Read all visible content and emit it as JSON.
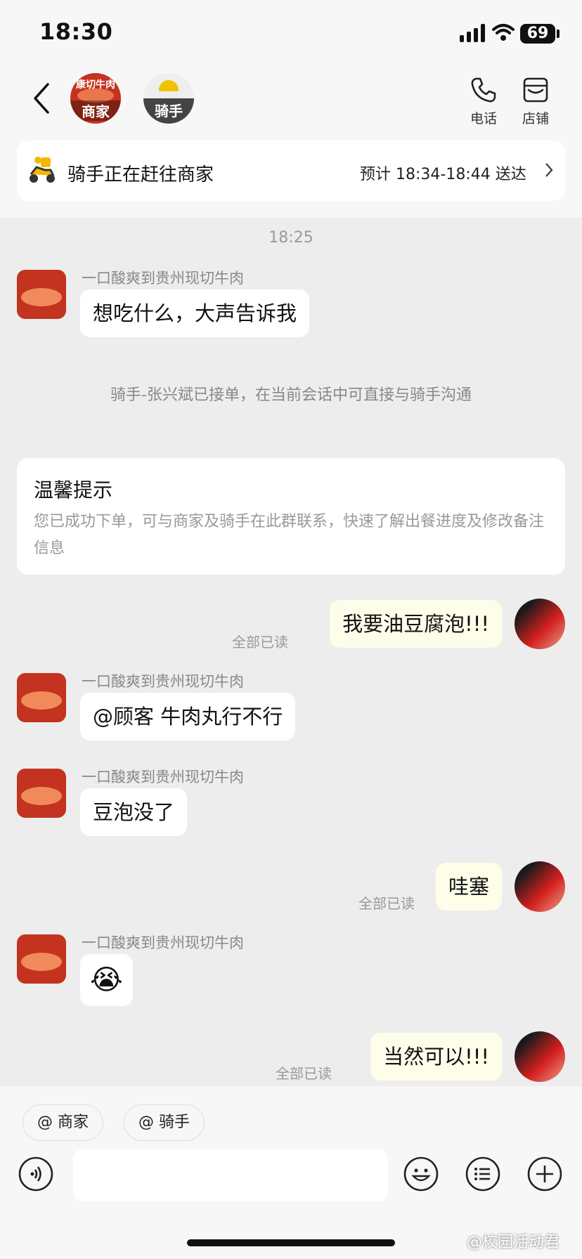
{
  "status_bar": {
    "time": "18:30",
    "battery": "69"
  },
  "header": {
    "merchant_tag": "商家",
    "merchant_logo_text": "康切牛肉",
    "rider_tag": "骑手",
    "phone_label": "电话",
    "store_label": "店铺"
  },
  "delivery": {
    "status": "骑手正在赶往商家",
    "eta": "预计 18:34-18:44 送达"
  },
  "chat": {
    "timestamp": "18:25",
    "sender_name": "一口酸爽到贵州现切牛肉",
    "msg1": "想吃什么，大声告诉我",
    "system_notice": "骑手-张兴斌已接单，在当前会话中可直接与骑手沟通",
    "tip_title": "温馨提示",
    "tip_body": "您已成功下单，可与商家及骑手在此群联系，快速了解出餐进度及修改备注信息",
    "msg2_out": "我要油豆腐泡!!!",
    "msg3": "@顾客 牛肉丸行不行",
    "msg4": "豆泡没了",
    "msg5_out": "哇塞",
    "msg6_emoji": "😭",
    "msg7_out": "当然可以!!!",
    "read_label": "全部已读"
  },
  "bottom": {
    "chip_merchant": "@ 商家",
    "chip_rider": "@ 骑手",
    "input_value": ""
  },
  "watermark": "@校园活动君"
}
